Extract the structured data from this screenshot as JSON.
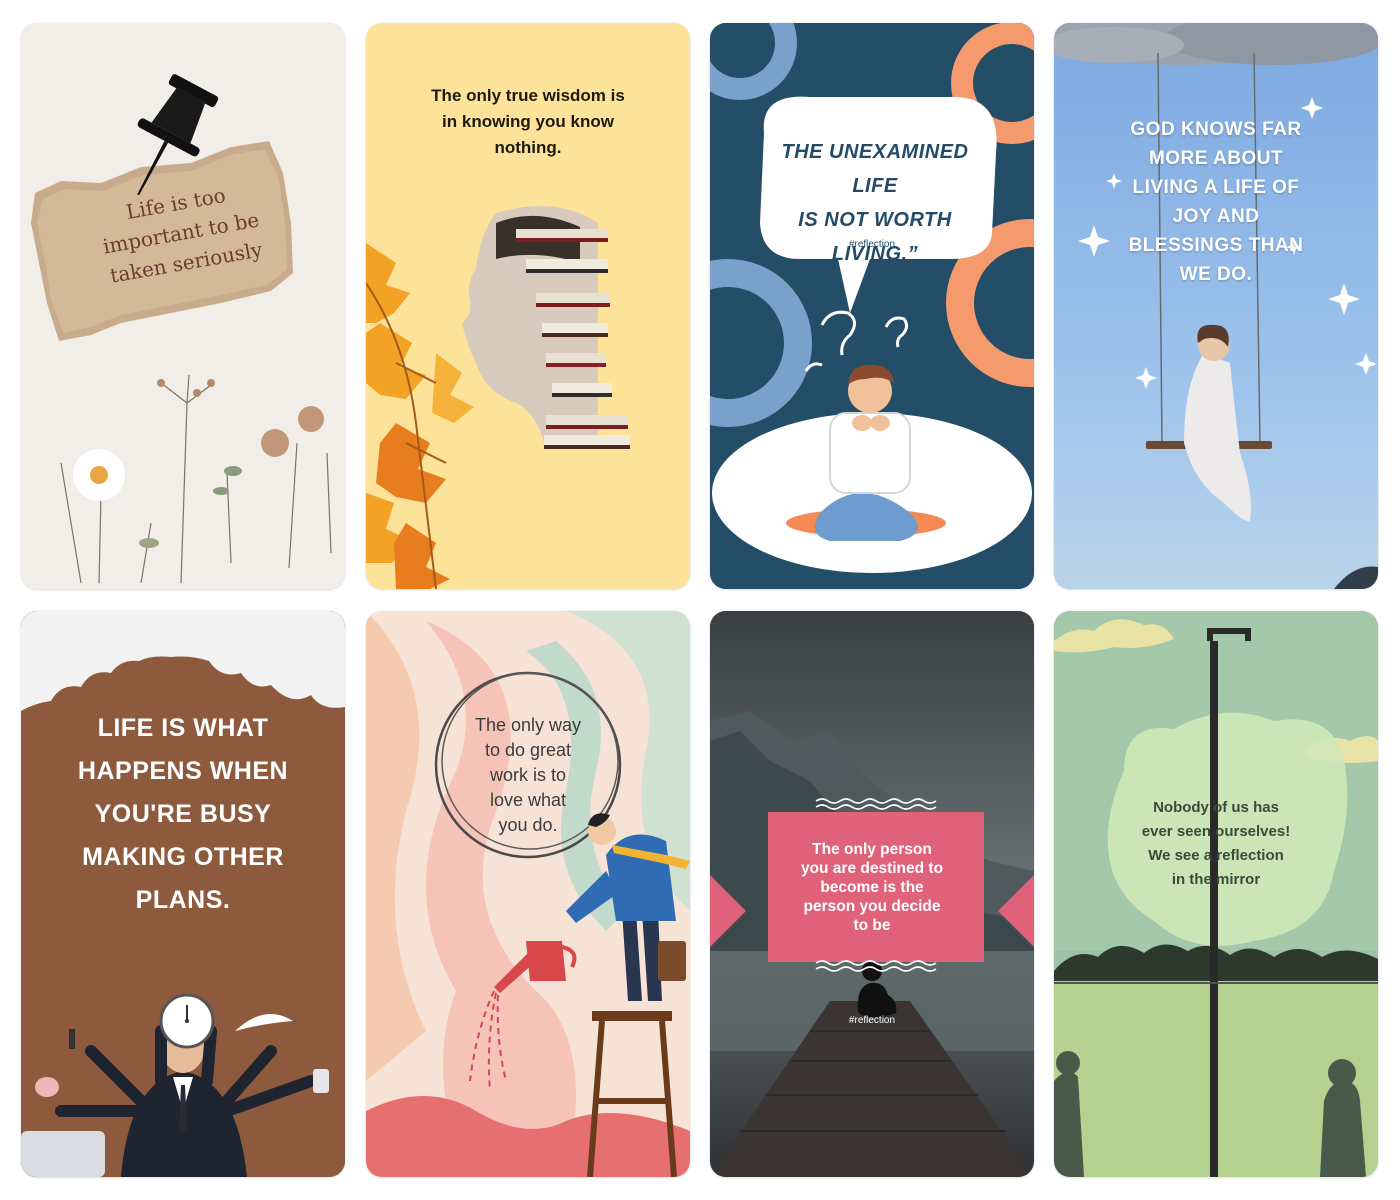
{
  "cards": [
    {
      "quote": "Life is too\nimportant to be\ntaken seriously"
    },
    {
      "quote": "The only true wisdom is\nin knowing you know\nnothing."
    },
    {
      "quote": "THE UNEXAMINED LIFE\nIS NOT WORTH\nLIVING.”",
      "tag": "#reflection"
    },
    {
      "quote": "GOD KNOWS FAR\nMORE ABOUT\nLIVING A LIFE OF\nJOY AND\nBLESSINGS THAN\nWE DO."
    },
    {
      "quote": "LIFE IS WHAT\nHAPPENS WHEN\nYOU'RE BUSY\nMAKING OTHER\nPLANS."
    },
    {
      "quote": "The only way\nto do great\nwork is to\nlove what\nyou do."
    },
    {
      "quote": "The only person\nyou are destined to\nbecome is the\nperson you decide\nto be",
      "tag": "#reflection"
    },
    {
      "quote": "Nobody of us has\never seen ourselves!\nWe see a reflection\nin the mirror"
    }
  ],
  "colors": {
    "card1_bg": "#f1eee9",
    "card2_bg": "#fde39a",
    "card3_bg": "#244d68",
    "card4_bg": "#8fb6e4",
    "card5_bg": "#8e5a3d",
    "card6_bg": "#f6e3d6",
    "card7_bg": "#4b5254",
    "card8_bg": "#9ec3a4",
    "accent_pink": "#e0627a",
    "accent_orange": "#f59a6c"
  }
}
